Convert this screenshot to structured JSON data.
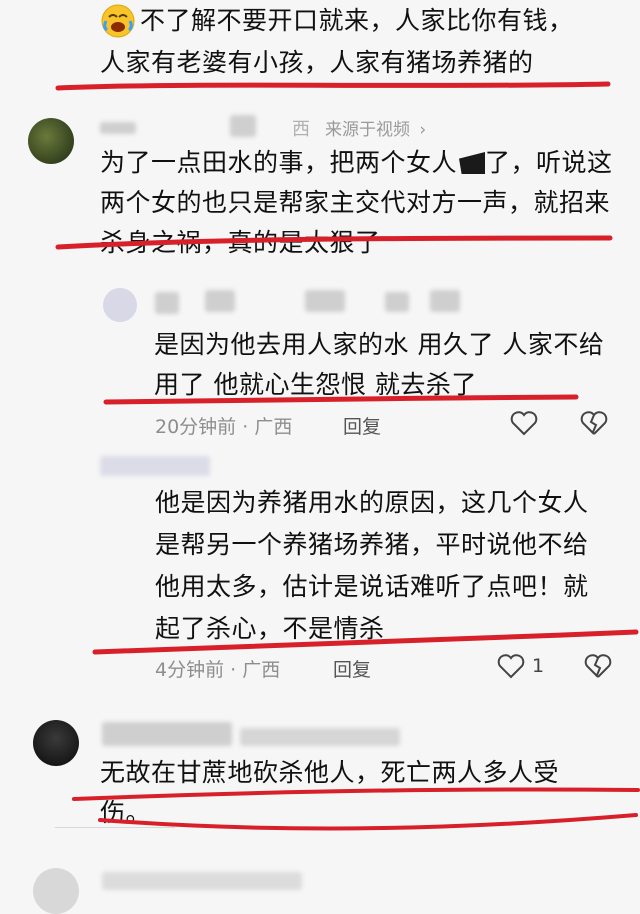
{
  "comments": [
    {
      "id": "c0",
      "emoji": "cry-laugh",
      "lines": [
        "不了解不要开口就来，人家比你有钱，",
        "人家有老婆有小孩，人家有猪场养猪的"
      ]
    },
    {
      "id": "c1",
      "name_suffix": "西",
      "source_label": "来源于视频",
      "lines": [
        "为了一点田水的事，把两个女人",
        "了，听说这",
        "两个女的也只是帮家主交代对方一声，就招来",
        "杀身之祸，真的是太狠了"
      ]
    },
    {
      "id": "r1",
      "lines": [
        "是因为他去用人家的水 用久了 人家不给",
        "用了 他就心生怨恨 就去杀了"
      ],
      "time": "20分钟前",
      "dot": "·",
      "location": "广西",
      "reply_label": "回复"
    },
    {
      "id": "r2",
      "lines": [
        "他是因为养猪用水的原因，这几个女人",
        "是帮另一个养猪场养猪，平时说他不给",
        "他用太多，估计是说话难听了点吧！就",
        "起了杀心，不是情杀"
      ],
      "time": "4分钟前",
      "dot": "·",
      "location": "广西",
      "reply_label": "回复",
      "like_count": "1"
    },
    {
      "id": "c3",
      "lines": [
        "无故在甘蔗地砍杀他人，死亡两人多人受",
        "伤。"
      ]
    }
  ],
  "colors": {
    "underline": "#d8202a",
    "meta": "#8e8e8e",
    "text": "#111111"
  },
  "icons": {
    "like": "heart-outline-icon",
    "dislike": "broken-heart-icon",
    "chevron": "chevron-right-icon"
  }
}
